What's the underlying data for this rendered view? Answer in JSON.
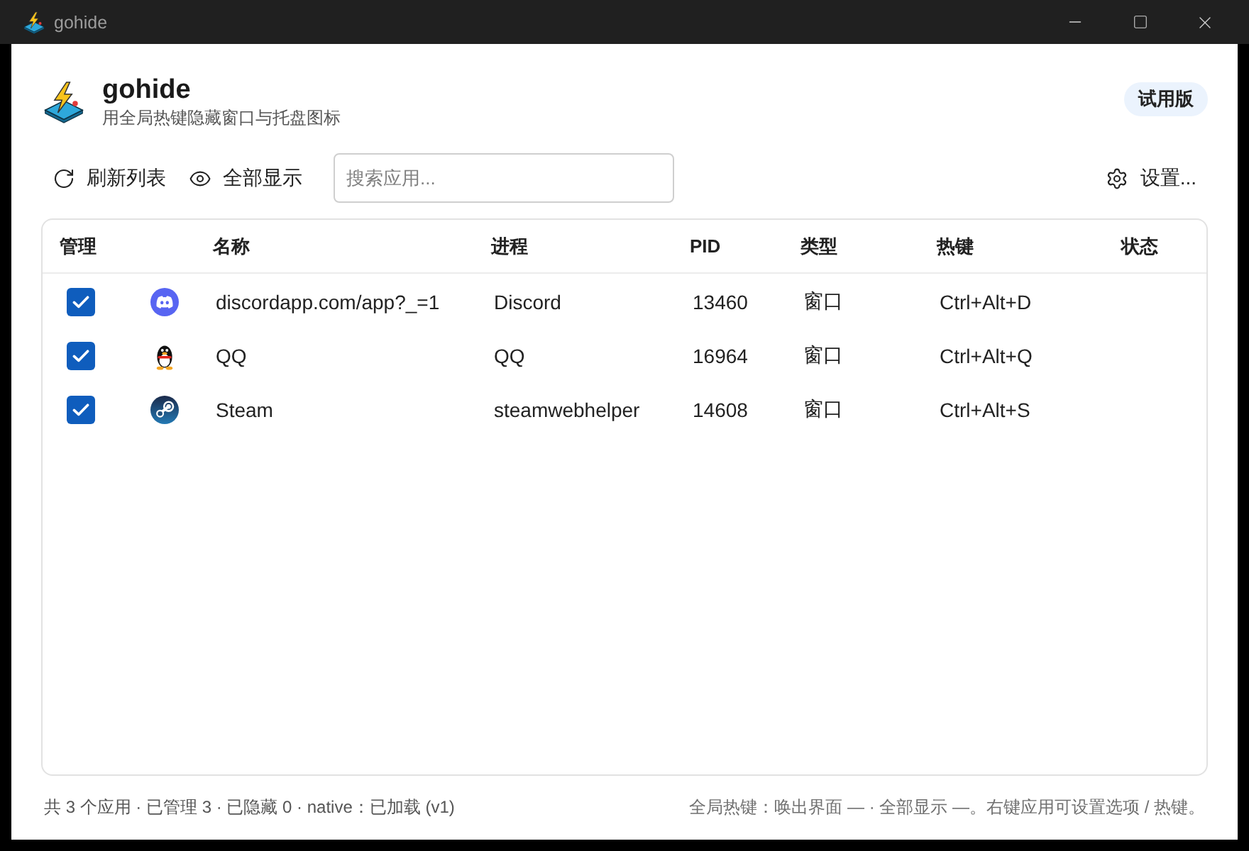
{
  "window": {
    "title": "gohide"
  },
  "header": {
    "app_name": "gohide",
    "subtitle": "用全局热键隐藏窗口与托盘图标",
    "badge": "试用版"
  },
  "toolbar": {
    "refresh": "刷新列表",
    "show_all": "全部显示",
    "search": {
      "placeholder": "搜索应用..."
    },
    "settings": "设置..."
  },
  "table": {
    "columns": [
      "管理",
      "名称",
      "进程",
      "PID",
      "类型",
      "热键",
      "状态"
    ],
    "rows": [
      {
        "kind": "discord",
        "managed": true,
        "name": "discordapp.com/app?_=1",
        "process": "Discord",
        "pid": "13460",
        "type": "窗口",
        "hotkey": "Ctrl+Alt+D"
      },
      {
        "kind": "qq",
        "managed": true,
        "name": "QQ",
        "process": "QQ",
        "pid": "16964",
        "type": "窗口",
        "hotkey": "Ctrl+Alt+Q"
      },
      {
        "kind": "steam",
        "managed": true,
        "name": "Steam",
        "process": "steamwebhelper",
        "pid": "14608",
        "type": "窗口",
        "hotkey": "Ctrl+Alt+S"
      }
    ]
  },
  "status_bar": {
    "left": "共 3 个应用 · 已管理 3 · 已隐藏 0 · native：已加载 (v1)",
    "right": "全局热键：唤出界面 — · 全部显示 —。右键应用可设置选项 / 热键。"
  }
}
